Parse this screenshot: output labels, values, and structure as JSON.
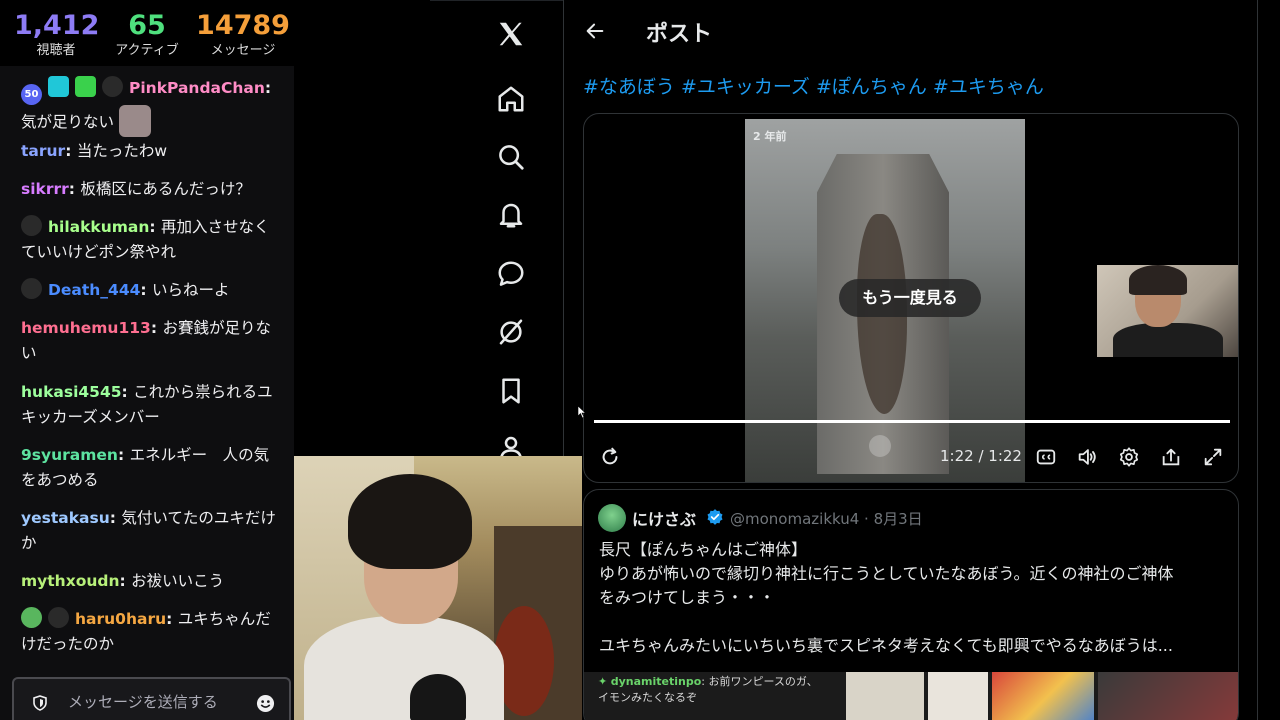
{
  "stats": {
    "viewers": {
      "value": "1,412",
      "label": "視聴者"
    },
    "active": {
      "value": "65",
      "label": "アクティブ"
    },
    "messages": {
      "value": "14789",
      "label": "メッセージ"
    }
  },
  "chat": {
    "messages": [
      {
        "user": "PinkPandaChan",
        "color": "#ff8cc6",
        "text": "気が足りない"
      },
      {
        "user": "tarur",
        "color": "#8aa4ff",
        "text": "当たったわw"
      },
      {
        "user": "sikrrr",
        "color": "#d77cff",
        "text": "板橋区にあるんだっけ？"
      },
      {
        "user": "hilakkuman",
        "color": "#a8ff8c",
        "text": "再加入させなくていいけどポン祭やれ"
      },
      {
        "user": "Death_444",
        "color": "#4b8cff",
        "text": "いらねーよ"
      },
      {
        "user": "hemuhemu113",
        "color": "#ff6f91",
        "text": "お賽銭が足りない"
      },
      {
        "user": "hukasi4545",
        "color": "#9dff9d",
        "text": "これから祟られるユキッカーズメンバー"
      },
      {
        "user": "9syuramen",
        "color": "#5de3a0",
        "text": "エネルギー　人の気をあつめる"
      },
      {
        "user": "yestakasu",
        "color": "#9fc9ff",
        "text": "気付いてたのユキだけか"
      },
      {
        "user": "mythxoudn",
        "color": "#b7f07a",
        "text": "お祓いいこう"
      },
      {
        "user": "haru0haru",
        "color": "#f5a742",
        "text": "ユキちゃんだけだったのか"
      }
    ],
    "badge_sub": "50",
    "input_placeholder": "メッセージを送信する"
  },
  "post": {
    "title": "ポスト",
    "hashtags": "#なあぼう #ユキッカーズ #ぽんちゃん #ユキちゃん",
    "video": {
      "ago": "2 年前",
      "replay_label": "もう一度見る",
      "time": "1:22 / 1:22",
      "progress": 1.0
    },
    "quote": {
      "name": "にけさぶ",
      "handle_date": "@monomazikku4 · 8月3日",
      "lines": [
        "長尺【ぽんちゃんはご神体】",
        "ゆりあが怖いので縁切り神社に行こうとしていたなあぼう。近くの神社のご神体",
        "をみつけてしまう・・・",
        "",
        "ユキちゃんみたいにいちいち裏でスピネタ考えなくても即興でやるなあぼうは..."
      ],
      "thumb_chat_user": "dynamitetinpo",
      "thumb_chat_text1": ": お前ワンピースのガ、",
      "thumb_chat_text2": "イモンみたくなるぞ"
    }
  },
  "nav": {
    "icons": [
      "x-logo-icon",
      "home-icon",
      "search-icon",
      "notifications-icon",
      "messages-icon",
      "grok-icon",
      "bookmarks-icon",
      "profile-icon"
    ]
  }
}
